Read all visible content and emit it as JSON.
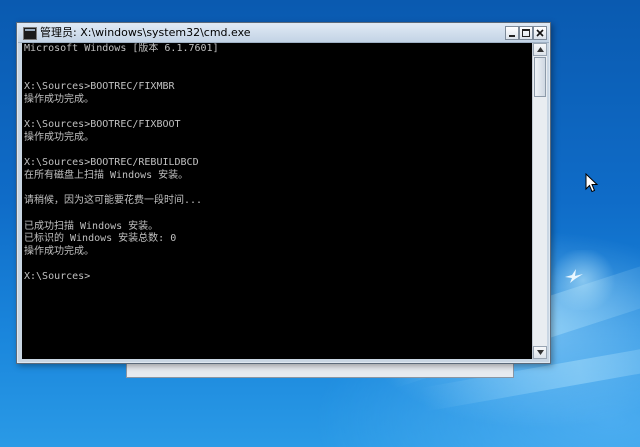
{
  "window": {
    "title": "管理员: X:\\windows\\system32\\cmd.exe"
  },
  "console": {
    "lines": [
      "Microsoft Windows [版本 6.1.7601]",
      "",
      "",
      "X:\\Sources>BOOTREC/FIXMBR",
      "操作成功完成。",
      "",
      "X:\\Sources>BOOTREC/FIXBOOT",
      "操作成功完成。",
      "",
      "X:\\Sources>BOOTREC/REBUILDBCD",
      "在所有磁盘上扫描 Windows 安装。",
      "",
      "请稍候，因为这可能要花费一段时间...",
      "",
      "已成功扫描 Windows 安装。",
      "已标识的 Windows 安装总数: 0",
      "操作成功完成。",
      "",
      "X:\\Sources>"
    ]
  },
  "colors": {
    "console_bg": "#000000",
    "console_fg": "#c0c0c0",
    "desktop": "#0f6cc8"
  }
}
